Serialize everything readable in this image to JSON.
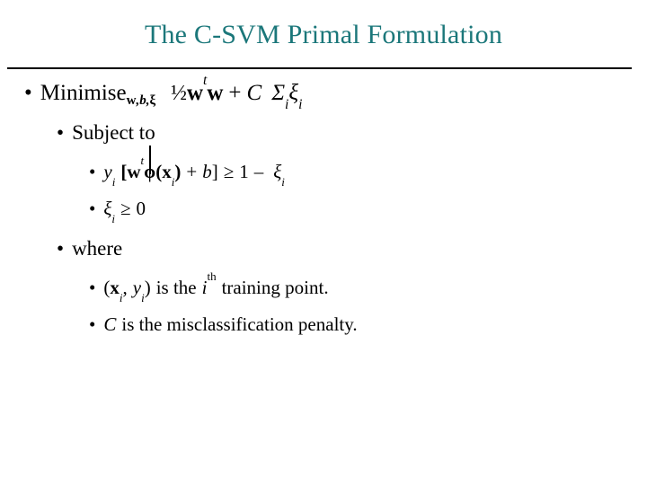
{
  "slide": {
    "title": "The C-SVM Primal Formulation",
    "title_color": "#1b777a",
    "background_color": "#ffffff",
    "text_color": "#000000",
    "bullet_glyph": "•"
  },
  "lines": {
    "minimise": {
      "label": "Minimise",
      "subscript_w": "w",
      "subscript_comma1": ",",
      "subscript_b": "b",
      "subscript_comma2": ",",
      "subscript_xi": "ξ",
      "half": "½",
      "w1": "w",
      "t1": "t",
      "w2": "w",
      "plus": "+",
      "C": "C",
      "sigma": "Σ",
      "sigma_sub": "i",
      "xi": "ξ",
      "xi_sub": "i"
    },
    "subject_to": {
      "label": "Subject to"
    },
    "constraint1": {
      "y": "y",
      "y_sub": "i",
      "open_bracket": "[",
      "w": "w",
      "t": "t",
      "phi": "ϕ",
      "open_paren": "(",
      "x": "x",
      "x_sub": "i",
      "close_paren": ")",
      "plus": "+",
      "b": "b",
      "close_bracket": "]",
      "geq": "≥",
      "one": "1",
      "minus": "–",
      "xi": "ξ",
      "xi_sub": "i"
    },
    "constraint2": {
      "xi": "ξ",
      "xi_sub": "i",
      "geq": "≥",
      "zero": "0"
    },
    "where": {
      "label": "where"
    },
    "def_point": {
      "open_paren": "(",
      "x": "x",
      "x_sub": "i",
      "comma": ",",
      "y": "y",
      "y_sub": "i",
      "close_paren": ")",
      "text1": "is the",
      "i": "i",
      "ordinal": "th",
      "text2": "training point."
    },
    "def_C": {
      "C": "C",
      "text": "is the misclassification penalty."
    }
  }
}
